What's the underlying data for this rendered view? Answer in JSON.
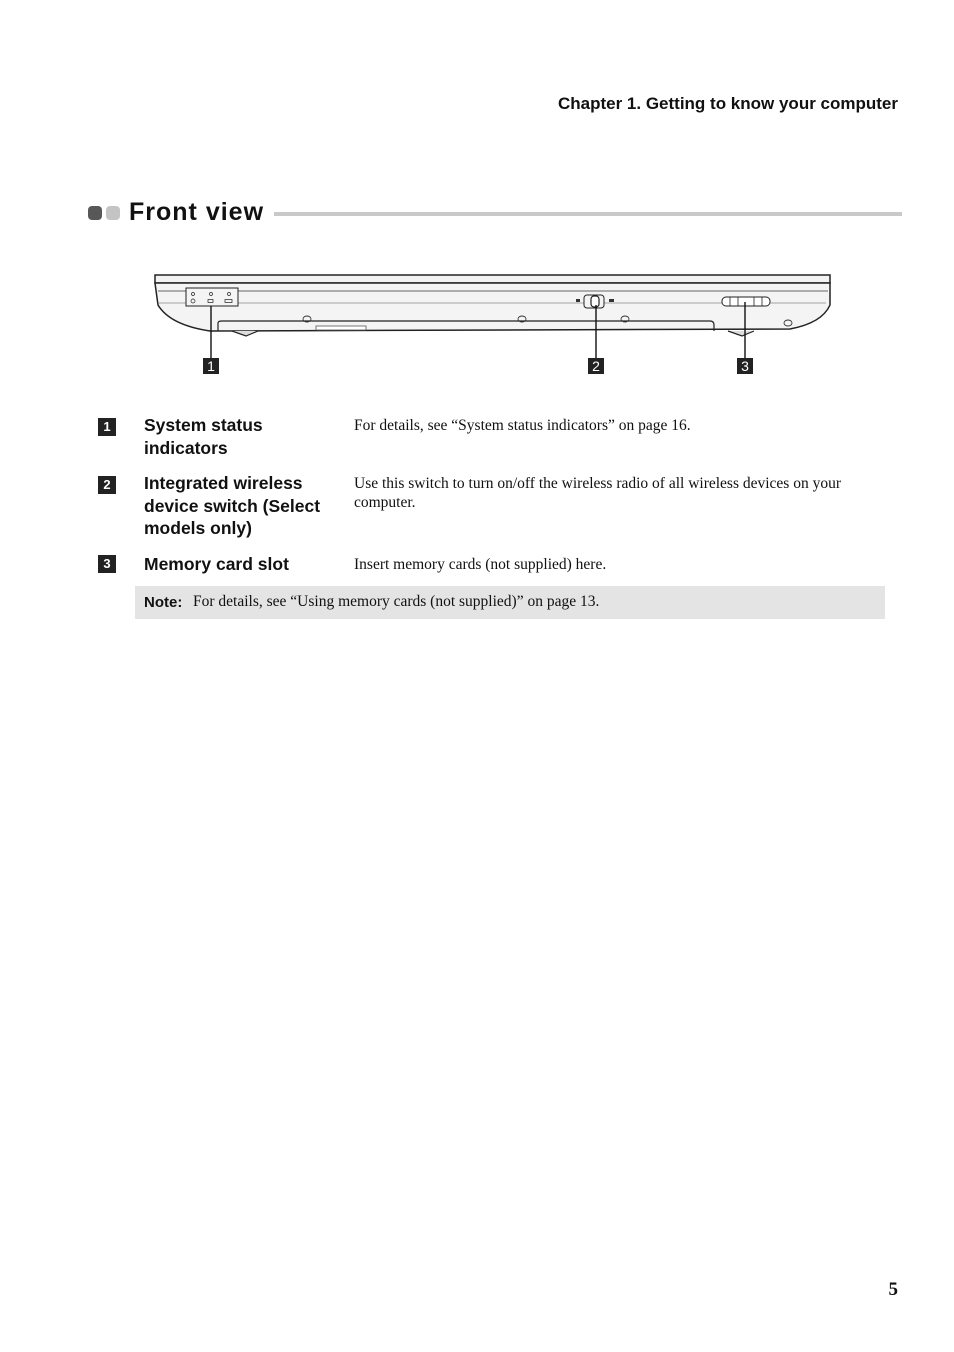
{
  "header": {
    "chapter": "Chapter 1. Getting to know your computer"
  },
  "section": {
    "title": "Front view"
  },
  "figure": {
    "description": "Front view illustration of laptop",
    "callouts": [
      "1",
      "2",
      "3"
    ],
    "indicator_icons": [
      "power-icon",
      "battery-icon",
      "wireless-icon"
    ]
  },
  "items": [
    {
      "number": "1",
      "title": "System status indicators",
      "description": "For details, see “System status indicators” on page 16."
    },
    {
      "number": "2",
      "title": "Integrated wireless device switch (Select models only)",
      "description": "Use this switch to turn on/off the wireless radio of all wireless devices on your computer."
    },
    {
      "number": "3",
      "title": "Memory card slot",
      "description": "Insert memory cards (not supplied) here."
    }
  ],
  "note": {
    "label": "Note:",
    "text": "For details, see “Using memory cards (not supplied)” on page 13."
  },
  "footer": {
    "page_number": "5"
  }
}
